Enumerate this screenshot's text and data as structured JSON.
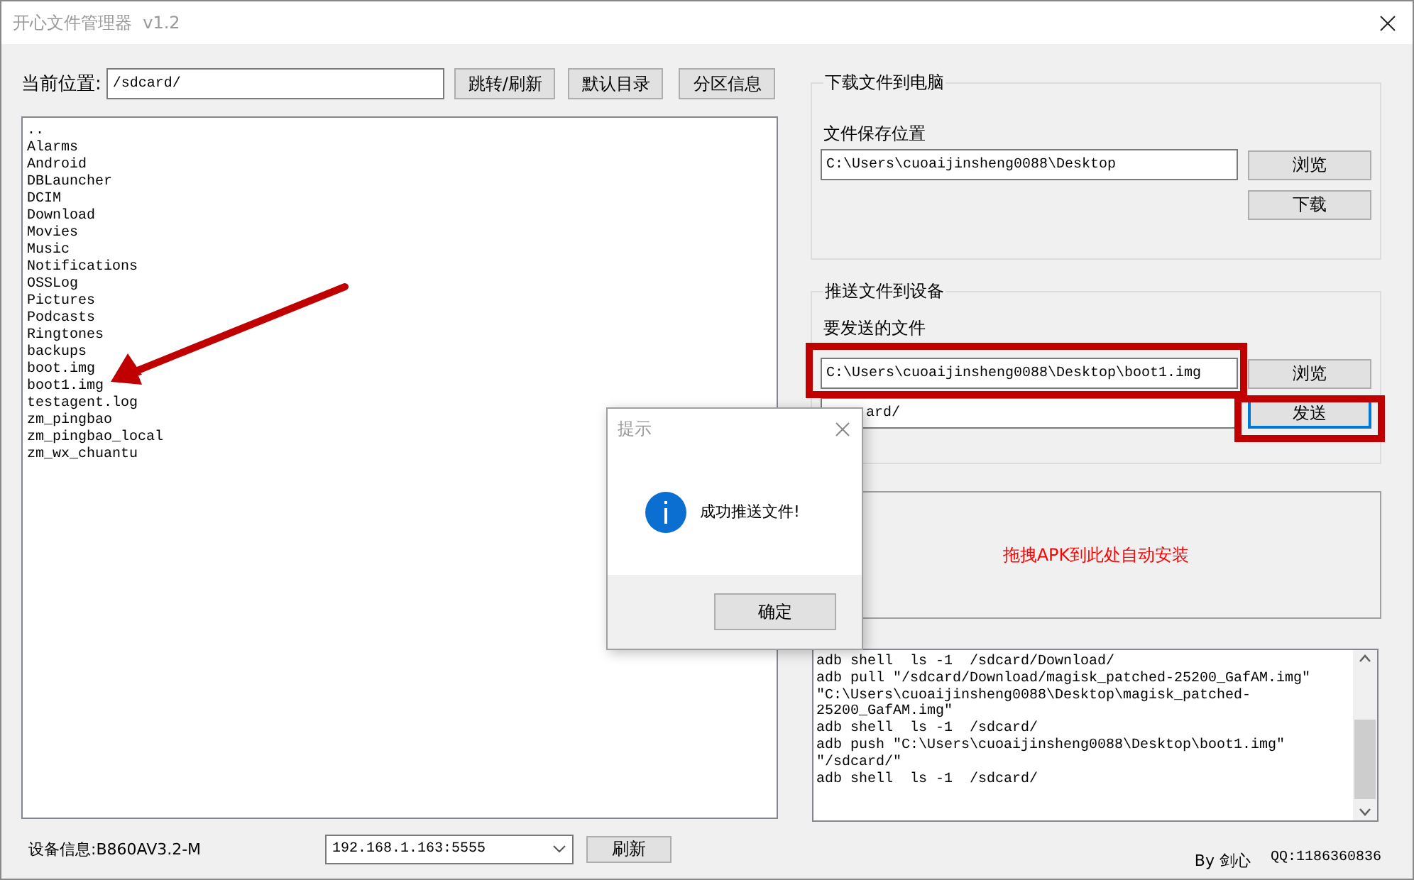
{
  "window": {
    "title": "开心文件管理器  v1.2"
  },
  "location": {
    "label": "当前位置:",
    "value": "/sdcard/",
    "buttons": [
      "跳转/刷新",
      "默认目录",
      "分区信息"
    ]
  },
  "files": [
    "..",
    "Alarms",
    "Android",
    "DBLauncher",
    "DCIM",
    "Download",
    "Movies",
    "Music",
    "Notifications",
    "OSSLog",
    "Pictures",
    "Podcasts",
    "Ringtones",
    "backups",
    "boot.img",
    "boot1.img",
    "testagent.log",
    "zm_pingbao",
    "zm_pingbao_local",
    "zm_wx_chuantu"
  ],
  "device": {
    "info": "设备信息:B860AV3.2-M",
    "address": "192.168.1.163:5555",
    "refresh": "刷新"
  },
  "download": {
    "title": "下载文件到电脑",
    "label": "文件保存位置",
    "path": "C:\\Users\\cuoaijinsheng0088\\Desktop",
    "browse": "浏览",
    "action": "下载"
  },
  "push": {
    "title": "推送文件到设备",
    "label": "要发送的文件",
    "file": "C:\\Users\\cuoaijinsheng0088\\Desktop\\boot1.img",
    "browse": "浏览",
    "target": "ard/",
    "action": "发送",
    "action_focused": true
  },
  "drop_zone": {
    "text": "拖拽APK到此处自动安装"
  },
  "log": [
    "adb shell  ls -1  /sdcard/Download/",
    "adb pull \"/sdcard/Download/magisk_patched-25200_GafAM.img\"",
    "\"C:\\Users\\cuoaijinsheng0088\\Desktop\\magisk_patched-",
    "25200_GafAM.img\"",
    "adb shell  ls -1  /sdcard/",
    "adb push \"C:\\Users\\cuoaijinsheng0088\\Desktop\\boot1.img\"",
    "\"/sdcard/\"",
    "adb shell  ls -1  /sdcard/"
  ],
  "footer": {
    "author": "By 剑心",
    "qq": "QQ:1186360836"
  },
  "dialog": {
    "title": "提示",
    "message": "成功推送文件!",
    "ok": "确定"
  },
  "annotations": [
    {
      "kind": "arrow",
      "color": "#c00000"
    },
    {
      "kind": "box",
      "color": "#c00000"
    },
    {
      "kind": "box",
      "color": "#c00000"
    }
  ]
}
